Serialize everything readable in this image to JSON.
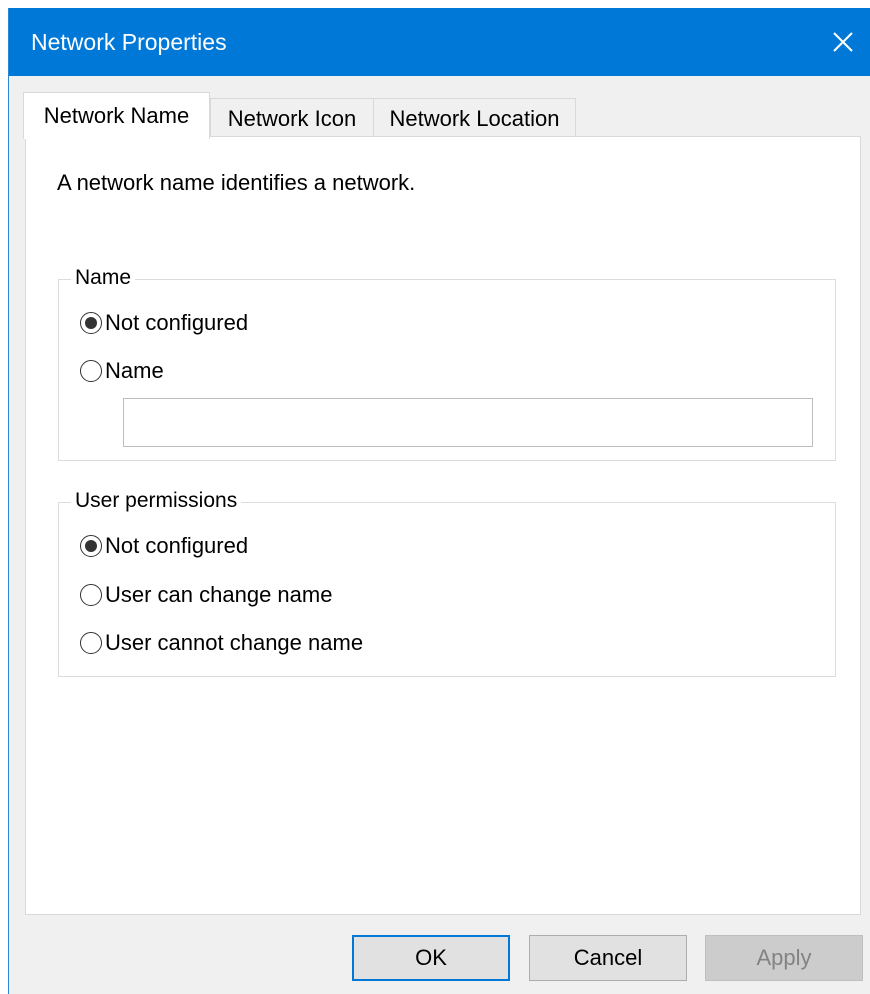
{
  "window": {
    "title": "Network Properties",
    "accent_color": "#0078d7"
  },
  "titlebar": {
    "close_icon": "close-icon"
  },
  "tabs": [
    {
      "label": "Network Name",
      "active": true
    },
    {
      "label": "Network Icon",
      "active": false
    },
    {
      "label": "Network Location",
      "active": false
    }
  ],
  "panel": {
    "description": "A network name identifies a network."
  },
  "name_group": {
    "legend": "Name",
    "options": [
      {
        "label": "Not configured",
        "selected": true
      },
      {
        "label": "Name",
        "selected": false
      }
    ],
    "name_value": "",
    "name_placeholder": ""
  },
  "permissions_group": {
    "legend": "User permissions",
    "options": [
      {
        "label": "Not configured",
        "selected": true
      },
      {
        "label": "User can change name",
        "selected": false
      },
      {
        "label": "User cannot change name",
        "selected": false
      }
    ]
  },
  "buttons": {
    "ok": "OK",
    "cancel": "Cancel",
    "apply": "Apply",
    "apply_disabled": true
  }
}
